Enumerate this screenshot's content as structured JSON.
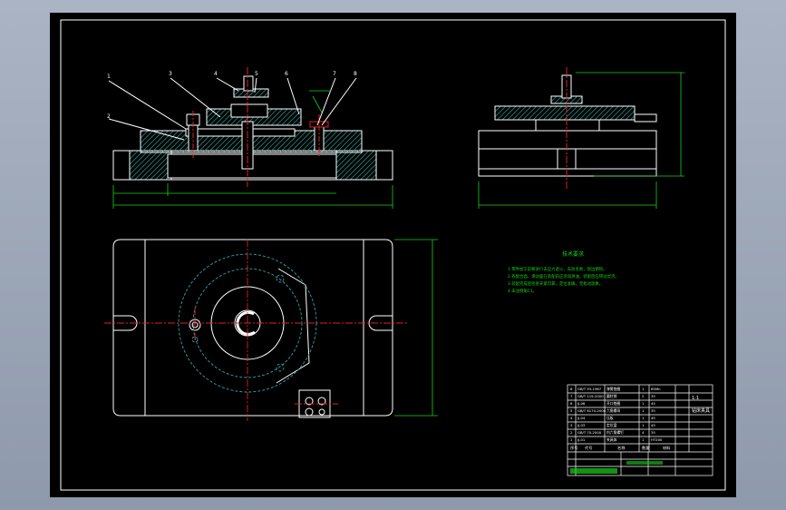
{
  "drawing": {
    "balloons": [
      "1",
      "2",
      "3",
      "4",
      "5",
      "6",
      "7",
      "8"
    ],
    "tech_req_title": "技术要求",
    "tech_req_lines": [
      "1.零件加工前要进行去应力退火，去除毛刺，锐边倒钝。",
      "2.各配合面、滑动面在装配前应涂润滑油，装配后应转动灵活。",
      "3.装配完成后检查夹紧可靠，定位准确，无松动现象。",
      "4.未注倒角C1。"
    ],
    "title_block": {
      "rows": [
        [
          "8",
          "GB/T 93-1987",
          "弹簧垫圈",
          "1",
          "65Mn"
        ],
        [
          "7",
          "GB/T 119-2000",
          "圆柱销",
          "2",
          "35"
        ],
        [
          "6",
          "JJ-06",
          "开口垫圈",
          "1",
          "45"
        ],
        [
          "5",
          "GB/T 6170-2000",
          "六角螺母",
          "1",
          "35"
        ],
        [
          "4",
          "JJ-04",
          "压板",
          "1",
          "45"
        ],
        [
          "3",
          "JJ-03",
          "定位盘",
          "1",
          "45"
        ],
        [
          "2",
          "GB/T 70-2000",
          "内六角螺钉",
          "4",
          "35"
        ],
        [
          "1",
          "JJ-01",
          "夹具体",
          "1",
          "HT200"
        ]
      ],
      "header": [
        "序号",
        "代号",
        "名称",
        "数量",
        "材料"
      ],
      "drawing_name": "钻床夹具",
      "scale": "1:1"
    }
  }
}
